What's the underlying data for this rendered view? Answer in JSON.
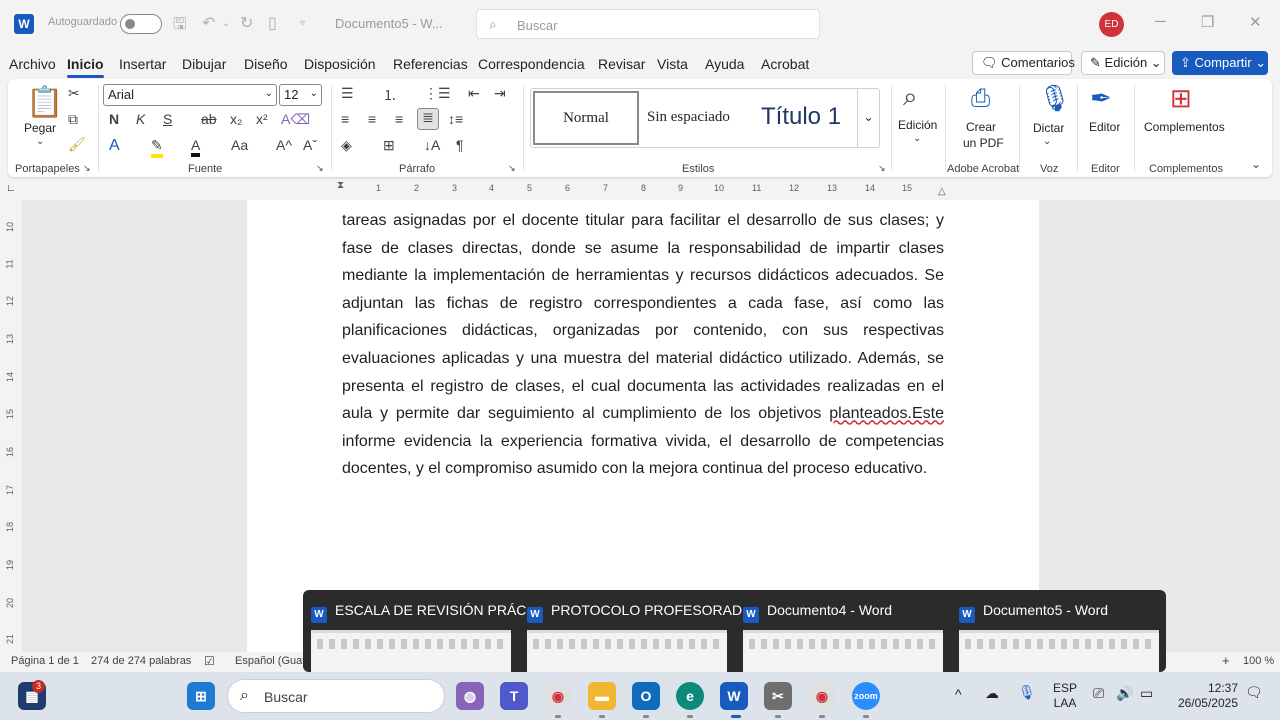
{
  "titlebar": {
    "autosave_label": "Autoguardado",
    "document_title": "Documento5 - W...",
    "search_placeholder": "Buscar",
    "avatar_initials": "ED"
  },
  "menu": {
    "tabs": [
      "Archivo",
      "Inicio",
      "Insertar",
      "Dibujar",
      "Diseño",
      "Disposición",
      "Referencias",
      "Correspondencia",
      "Revisar",
      "Vista",
      "Ayuda",
      "Acrobat"
    ],
    "active_tab": "Inicio",
    "comments_label": "Comentarios",
    "editing_label": "Edición",
    "share_label": "Compartir"
  },
  "ribbon": {
    "paste_label": "Pegar",
    "font_name": "Arial",
    "font_size": "12",
    "styles": {
      "normal": "Normal",
      "no_spacing": "Sin espaciado",
      "title1": "Título 1"
    },
    "edicion_label": "Edición",
    "create_pdf_label_1": "Crear",
    "create_pdf_label_2": "un PDF",
    "dictate_label": "Dictar",
    "editor_label": "Editor",
    "addins_label": "Complementos",
    "groups": {
      "clipboard": "Portapapeles",
      "font": "Fuente",
      "paragraph": "Párrafo",
      "styles": "Estilos",
      "adobe": "Adobe Acrobat",
      "voice": "Voz",
      "editor": "Editor",
      "addins": "Complementos"
    }
  },
  "ruler": {
    "h_numbers": [
      "1",
      "2",
      "3",
      "4",
      "5",
      "6",
      "7",
      "8",
      "9",
      "10",
      "11",
      "12",
      "13",
      "14",
      "15"
    ],
    "v_numbers": [
      "10",
      "11",
      "12",
      "13",
      "14",
      "15",
      "16",
      "17",
      "18",
      "19",
      "20",
      "21"
    ]
  },
  "document": {
    "text_before": "tareas asignadas por el docente titular para facilitar el desarrollo de sus clases; y fase de clases directas, donde se asume la responsabilidad de impartir clases mediante la implementación de herramientas y recursos didácticos adecuados. Se adjuntan las fichas de registro correspondientes a cada fase, así como las planificaciones didácticas, organizadas por contenido, con sus respectivas evaluaciones aplicadas y una muestra del material didáctico utilizado. Además, se presenta el registro de clases, el cual documenta las actividades realizadas en el aula y permite dar seguimiento al cumplimiento de los objetivos ",
    "text_misspelled": "planteados.Este",
    "text_after": " informe evidencia la experiencia formativa vivida, el desarrollo de competencias docentes, y el compromiso asumido con la mejora continua del proceso educativo."
  },
  "statusbar": {
    "page": "Página 1 de 1",
    "words": "274 de 274 palabras",
    "language": "Español (Guate",
    "zoom": "100 %"
  },
  "preview": {
    "windows": [
      {
        "title": "ESCALA DE REVISIÓN PRÁC..."
      },
      {
        "title": "PROTOCOLO PROFESORAD..."
      },
      {
        "title": "Documento4 - Word"
      },
      {
        "title": "Documento5 - Word"
      }
    ]
  },
  "taskbar": {
    "search_placeholder": "Buscar",
    "notification_count": "3",
    "lang_1": "ESP",
    "lang_2": "LAA",
    "time": "12:37",
    "date": "26/05/2025"
  },
  "colors": {
    "accent": "#185abd",
    "avatar": "#d13438"
  }
}
